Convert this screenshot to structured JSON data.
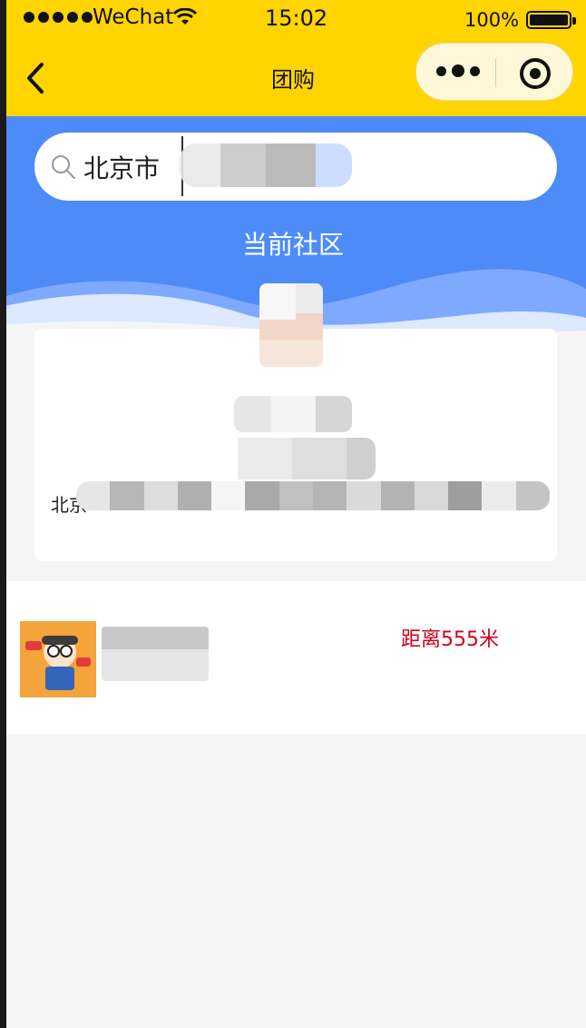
{
  "status_bar": {
    "carrier": "WeChat",
    "time": "15:02",
    "battery": "100%"
  },
  "nav": {
    "title": "团购"
  },
  "search": {
    "city": "北京市"
  },
  "header": {
    "community_title": "当前社区"
  },
  "card": {
    "leader_name": "团长",
    "address_prefix": "北京"
  },
  "shop_list": [
    {
      "name": "",
      "distance": "距离555米"
    }
  ],
  "colors": {
    "nav_yellow": "#ffd400",
    "header_blue": "#4d8cf8",
    "distance_red": "#d0021b"
  }
}
